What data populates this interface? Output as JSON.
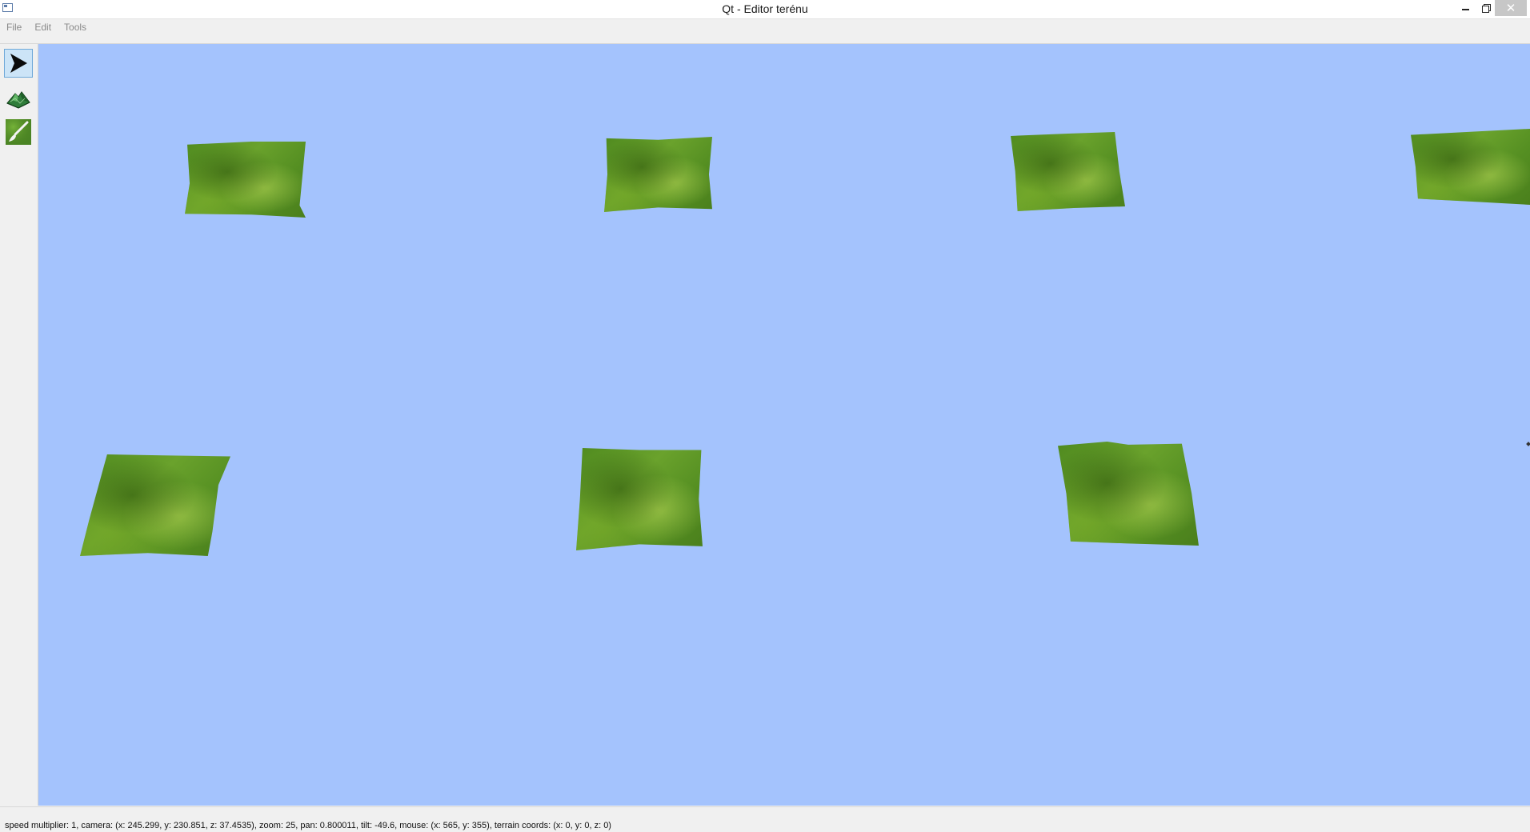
{
  "window": {
    "title": "Qt - Editor terénu"
  },
  "menu": {
    "items": [
      {
        "label": "File"
      },
      {
        "label": "Edit"
      },
      {
        "label": "Tools"
      }
    ]
  },
  "toolbar": {
    "tools": [
      {
        "icon": "cursor-arrow-icon",
        "active": true
      },
      {
        "icon": "terrain-mountain-icon",
        "active": false
      },
      {
        "icon": "paint-brush-icon",
        "active": false
      }
    ]
  },
  "viewport": {
    "background": "#a4c3fd",
    "terrain_patch_count": 7
  },
  "status": {
    "text": "speed multiplier: 1, camera: (x: 245.299, y: 230.851, z: 37.4535), zoom: 25, pan: 0.800011, tilt: -49.6, mouse: (x: 565, y: 355), terrain coords: (x: 0, y: 0, z: 0)"
  }
}
